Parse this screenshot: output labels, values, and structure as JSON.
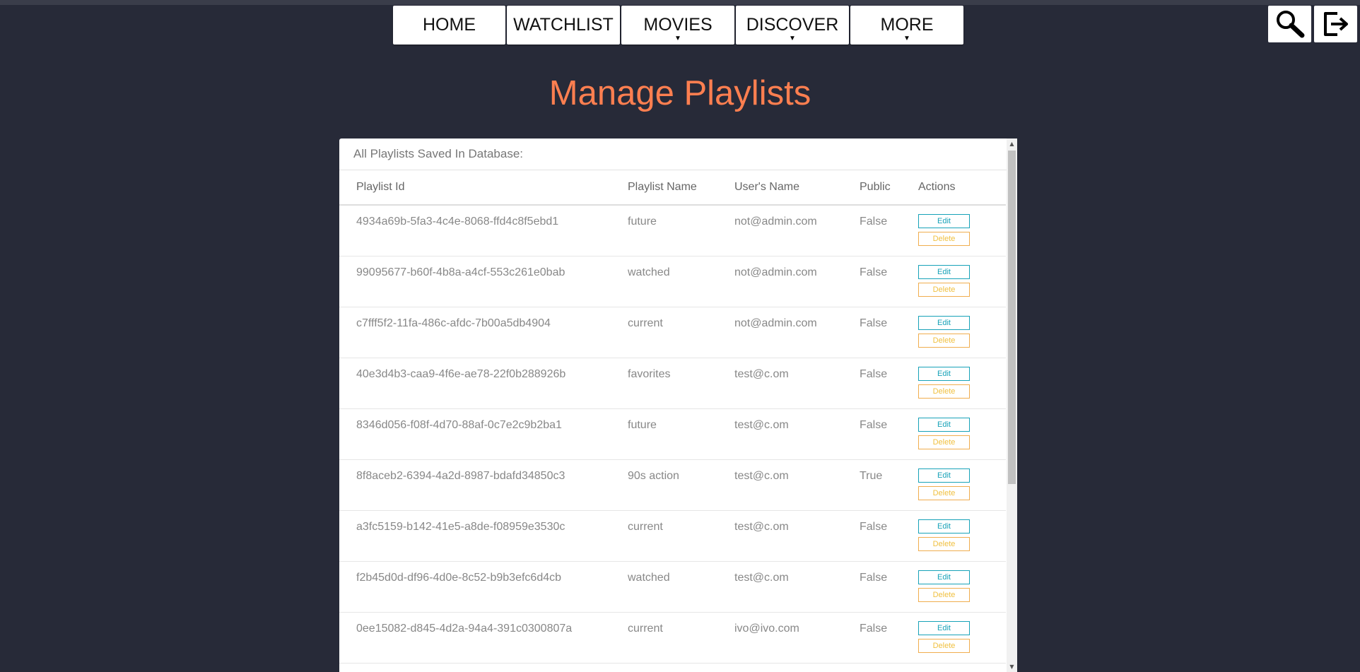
{
  "nav": {
    "items": [
      {
        "label": "HOME",
        "dropdown": false
      },
      {
        "label": "WATCHLIST",
        "dropdown": false
      },
      {
        "label": "MOVIES",
        "dropdown": true
      },
      {
        "label": "DISCOVER",
        "dropdown": true
      },
      {
        "label": "MORE",
        "dropdown": true
      }
    ],
    "caret": "▼"
  },
  "toolbar": {
    "search_icon": "search-icon",
    "logout_icon": "logout-icon"
  },
  "page": {
    "title": "Manage Playlists"
  },
  "panel": {
    "header": "All Playlists Saved In Database:",
    "columns": [
      "Playlist Id",
      "Playlist Name",
      "User's Name",
      "Public",
      "Actions"
    ],
    "edit_label": "Edit",
    "delete_label": "Delete",
    "rows": [
      {
        "id": "4934a69b-5fa3-4c4e-8068-ffd4c8f5ebd1",
        "name": "future",
        "user": "not@admin.com",
        "public": "False"
      },
      {
        "id": "99095677-b60f-4b8a-a4cf-553c261e0bab",
        "name": "watched",
        "user": "not@admin.com",
        "public": "False"
      },
      {
        "id": "c7fff5f2-11fa-486c-afdc-7b00a5db4904",
        "name": "current",
        "user": "not@admin.com",
        "public": "False"
      },
      {
        "id": "40e3d4b3-caa9-4f6e-ae78-22f0b288926b",
        "name": "favorites",
        "user": "test@c.om",
        "public": "False"
      },
      {
        "id": "8346d056-f08f-4d70-88af-0c7e2c9b2ba1",
        "name": "future",
        "user": "test@c.om",
        "public": "False"
      },
      {
        "id": "8f8aceb2-6394-4a2d-8987-bdafd34850c3",
        "name": "90s action",
        "user": "test@c.om",
        "public": "True"
      },
      {
        "id": "a3fc5159-b142-41e5-a8de-f08959e3530c",
        "name": "current",
        "user": "test@c.om",
        "public": "False"
      },
      {
        "id": "f2b45d0d-df96-4d0e-8c52-b9b3efc6d4cb",
        "name": "watched",
        "user": "test@c.om",
        "public": "False"
      },
      {
        "id": "0ee15082-d845-4d2a-94a4-391c0300807a",
        "name": "current",
        "user": "ivo@ivo.com",
        "public": "False"
      }
    ]
  },
  "colors": {
    "background": "#272a38",
    "title": "#ff7f50",
    "edit": "#17a2b8",
    "delete": "#f0ad4e"
  }
}
